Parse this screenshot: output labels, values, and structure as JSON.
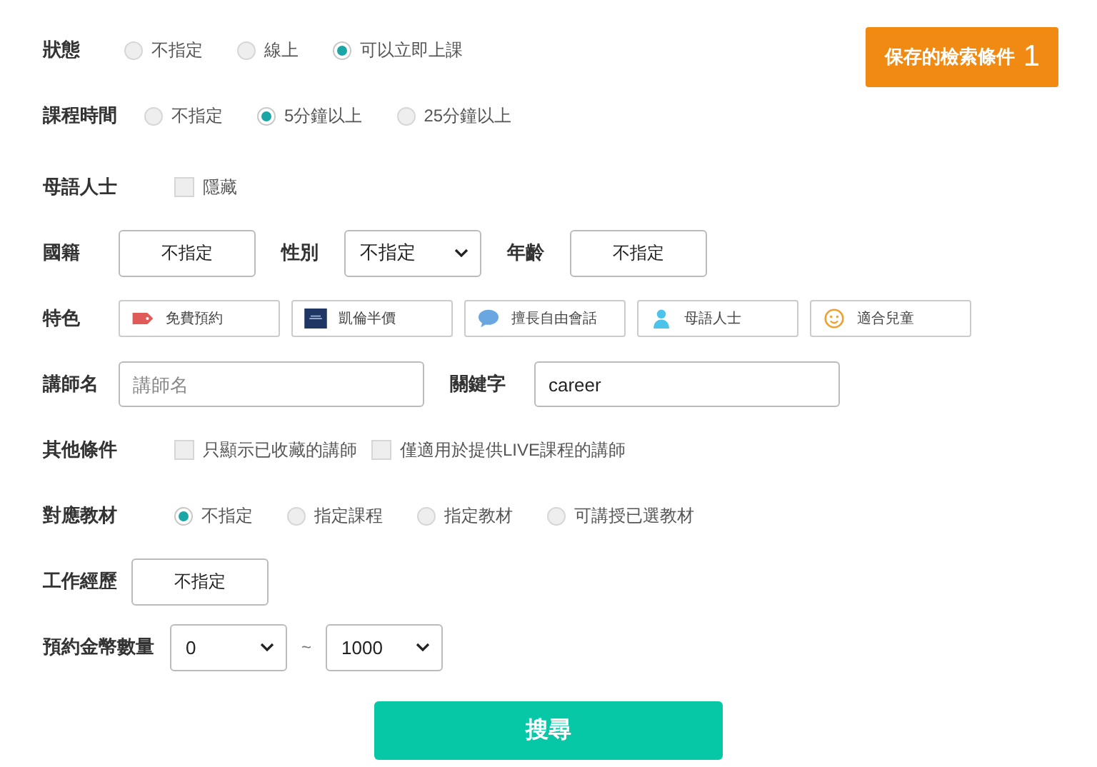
{
  "saved_search": {
    "label": "保存的檢索條件",
    "count": "1"
  },
  "status": {
    "label": "狀態",
    "options": [
      {
        "label": "不指定",
        "selected": false
      },
      {
        "label": "線上",
        "selected": false
      },
      {
        "label": "可以立即上課",
        "selected": true
      }
    ]
  },
  "lesson_time": {
    "label": "課程時間",
    "options": [
      {
        "label": "不指定",
        "selected": false
      },
      {
        "label": "5分鐘以上",
        "selected": true
      },
      {
        "label": "25分鐘以上",
        "selected": false
      }
    ]
  },
  "native": {
    "label": "母語人士",
    "checkbox": {
      "label": "隱藏",
      "checked": false
    }
  },
  "filters": [
    {
      "label": "國籍",
      "kind": "button",
      "value": "不指定"
    },
    {
      "label": "性別",
      "kind": "select",
      "value": "不指定"
    },
    {
      "label": "年齡",
      "kind": "button",
      "value": "不指定"
    }
  ],
  "features": {
    "label": "特色",
    "items": [
      {
        "label": "免費預約",
        "kind": "tag"
      },
      {
        "label": "凱倫半價",
        "kind": "book"
      },
      {
        "label": "擅長自由會話",
        "kind": "bubble"
      },
      {
        "label": "母語人士",
        "kind": "person"
      },
      {
        "label": "適合兒童",
        "kind": "smiley"
      }
    ]
  },
  "teacher_name": {
    "label": "講師名",
    "placeholder": "講師名"
  },
  "keyword": {
    "label": "關鍵字",
    "value": "career"
  },
  "other": {
    "label": "其他條件",
    "checkboxes": [
      {
        "label": "只顯示已收藏的講師",
        "checked": false
      },
      {
        "label": "僅適用於提供LIVE課程的講師",
        "checked": false
      }
    ]
  },
  "material": {
    "label": "對應教材",
    "options": [
      {
        "label": "不指定",
        "selected": true
      },
      {
        "label": "指定課程",
        "selected": false
      },
      {
        "label": "指定教材",
        "selected": false
      },
      {
        "label": "可講授已選教材",
        "selected": false
      }
    ]
  },
  "experience": {
    "label": "工作經歷",
    "value": "不指定"
  },
  "coins": {
    "label": "預約金幣數量",
    "min": "0",
    "separator": "~",
    "max": "1000"
  },
  "search_button": "搜尋"
}
